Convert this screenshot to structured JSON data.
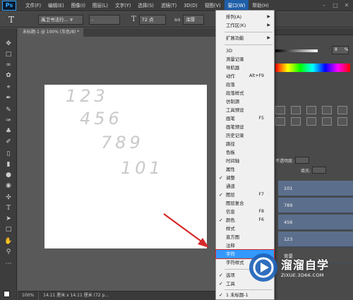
{
  "app": {
    "logo": "Ps"
  },
  "menubar": {
    "items": [
      "文件(F)",
      "编辑(E)",
      "图像(I)",
      "图层(L)",
      "文字(Y)",
      "选择(S)",
      "滤镜(T)",
      "3D(D)",
      "视图(V)",
      "窗口(W)",
      "帮助(H)"
    ],
    "active_index": 9
  },
  "optionsbar": {
    "tool_glyph": "T",
    "font_family": "禹卫书法行...",
    "font_style": "-",
    "size_glyph": "T",
    "font_size": "72 点",
    "aa_prefix": "aa",
    "antialias": "浑厚"
  },
  "document": {
    "tab_label": "未标题-1 @ 100% (灰色/8) *",
    "texts": [
      "123",
      "456",
      "789",
      "101"
    ]
  },
  "statusbar": {
    "zoom": "100%",
    "info": "14.11 厘米 x 14.11 厘米 (72 p..."
  },
  "right_panel": {
    "opacity_value": "8",
    "opacity_unit": "%",
    "opacity_label": "不透明度:",
    "fill_label": "填充:",
    "layers": [
      "101",
      "789",
      "456",
      "123",
      "背景"
    ]
  },
  "window_menu": {
    "items": [
      {
        "label": "排列(A)",
        "shortcut": "",
        "submenu": true,
        "checked": false,
        "highlighted": false
      },
      {
        "label": "工作区(K)",
        "shortcut": "",
        "submenu": true,
        "checked": false,
        "highlighted": false
      },
      {
        "label": "扩展功能",
        "shortcut": "",
        "submenu": true,
        "checked": false,
        "highlighted": false
      },
      {
        "label": "3D",
        "shortcut": "",
        "submenu": false,
        "checked": false,
        "highlighted": false
      },
      {
        "label": "测量记录",
        "shortcut": "",
        "submenu": false,
        "checked": false,
        "highlighted": false
      },
      {
        "label": "导航器",
        "shortcut": "",
        "submenu": false,
        "checked": false,
        "highlighted": false
      },
      {
        "label": "动作",
        "shortcut": "Alt+F9",
        "submenu": false,
        "checked": false,
        "highlighted": false
      },
      {
        "label": "段落",
        "shortcut": "",
        "submenu": false,
        "checked": false,
        "highlighted": false
      },
      {
        "label": "段落样式",
        "shortcut": "",
        "submenu": false,
        "checked": false,
        "highlighted": false
      },
      {
        "label": "仿制源",
        "shortcut": "",
        "submenu": false,
        "checked": false,
        "highlighted": false
      },
      {
        "label": "工具预设",
        "shortcut": "",
        "submenu": false,
        "checked": false,
        "highlighted": false
      },
      {
        "label": "画笔",
        "shortcut": "F5",
        "submenu": false,
        "checked": false,
        "highlighted": false
      },
      {
        "label": "画笔预设",
        "shortcut": "",
        "submenu": false,
        "checked": false,
        "highlighted": false
      },
      {
        "label": "历史记录",
        "shortcut": "",
        "submenu": false,
        "checked": false,
        "highlighted": false
      },
      {
        "label": "路径",
        "shortcut": "",
        "submenu": false,
        "checked": false,
        "highlighted": false
      },
      {
        "label": "色板",
        "shortcut": "",
        "submenu": false,
        "checked": false,
        "highlighted": false
      },
      {
        "label": "时间轴",
        "shortcut": "",
        "submenu": false,
        "checked": false,
        "highlighted": false
      },
      {
        "label": "属性",
        "shortcut": "",
        "submenu": false,
        "checked": false,
        "highlighted": false
      },
      {
        "label": "调整",
        "shortcut": "",
        "submenu": false,
        "checked": true,
        "highlighted": false
      },
      {
        "label": "通道",
        "shortcut": "",
        "submenu": false,
        "checked": false,
        "highlighted": false
      },
      {
        "label": "图层",
        "shortcut": "F7",
        "submenu": false,
        "checked": true,
        "highlighted": false
      },
      {
        "label": "图层复合",
        "shortcut": "",
        "submenu": false,
        "checked": false,
        "highlighted": false
      },
      {
        "label": "信息",
        "shortcut": "F8",
        "submenu": false,
        "checked": false,
        "highlighted": false
      },
      {
        "label": "颜色",
        "shortcut": "F6",
        "submenu": false,
        "checked": true,
        "highlighted": false
      },
      {
        "label": "样式",
        "shortcut": "",
        "submenu": false,
        "checked": false,
        "highlighted": false
      },
      {
        "label": "直方图",
        "shortcut": "",
        "submenu": false,
        "checked": false,
        "highlighted": false
      },
      {
        "label": "注释",
        "shortcut": "",
        "submenu": false,
        "checked": false,
        "highlighted": false
      },
      {
        "label": "字符",
        "shortcut": "",
        "submenu": false,
        "checked": false,
        "highlighted": true
      },
      {
        "label": "字符样式",
        "shortcut": "",
        "submenu": false,
        "checked": false,
        "highlighted": false
      },
      {
        "label": "选项",
        "shortcut": "",
        "submenu": false,
        "checked": true,
        "highlighted": false
      },
      {
        "label": "工具",
        "shortcut": "",
        "submenu": false,
        "checked": true,
        "highlighted": false
      },
      {
        "label": "1 未标题-1",
        "shortcut": "",
        "submenu": false,
        "checked": true,
        "highlighted": false
      }
    ]
  },
  "watermark": {
    "title": "溜溜自学",
    "subtitle": "ZIXUE.3D66.COM"
  },
  "colors": {
    "accent": "#3399ff",
    "annotation": "#d62a2a",
    "layer_row": "#5b6f8c"
  }
}
